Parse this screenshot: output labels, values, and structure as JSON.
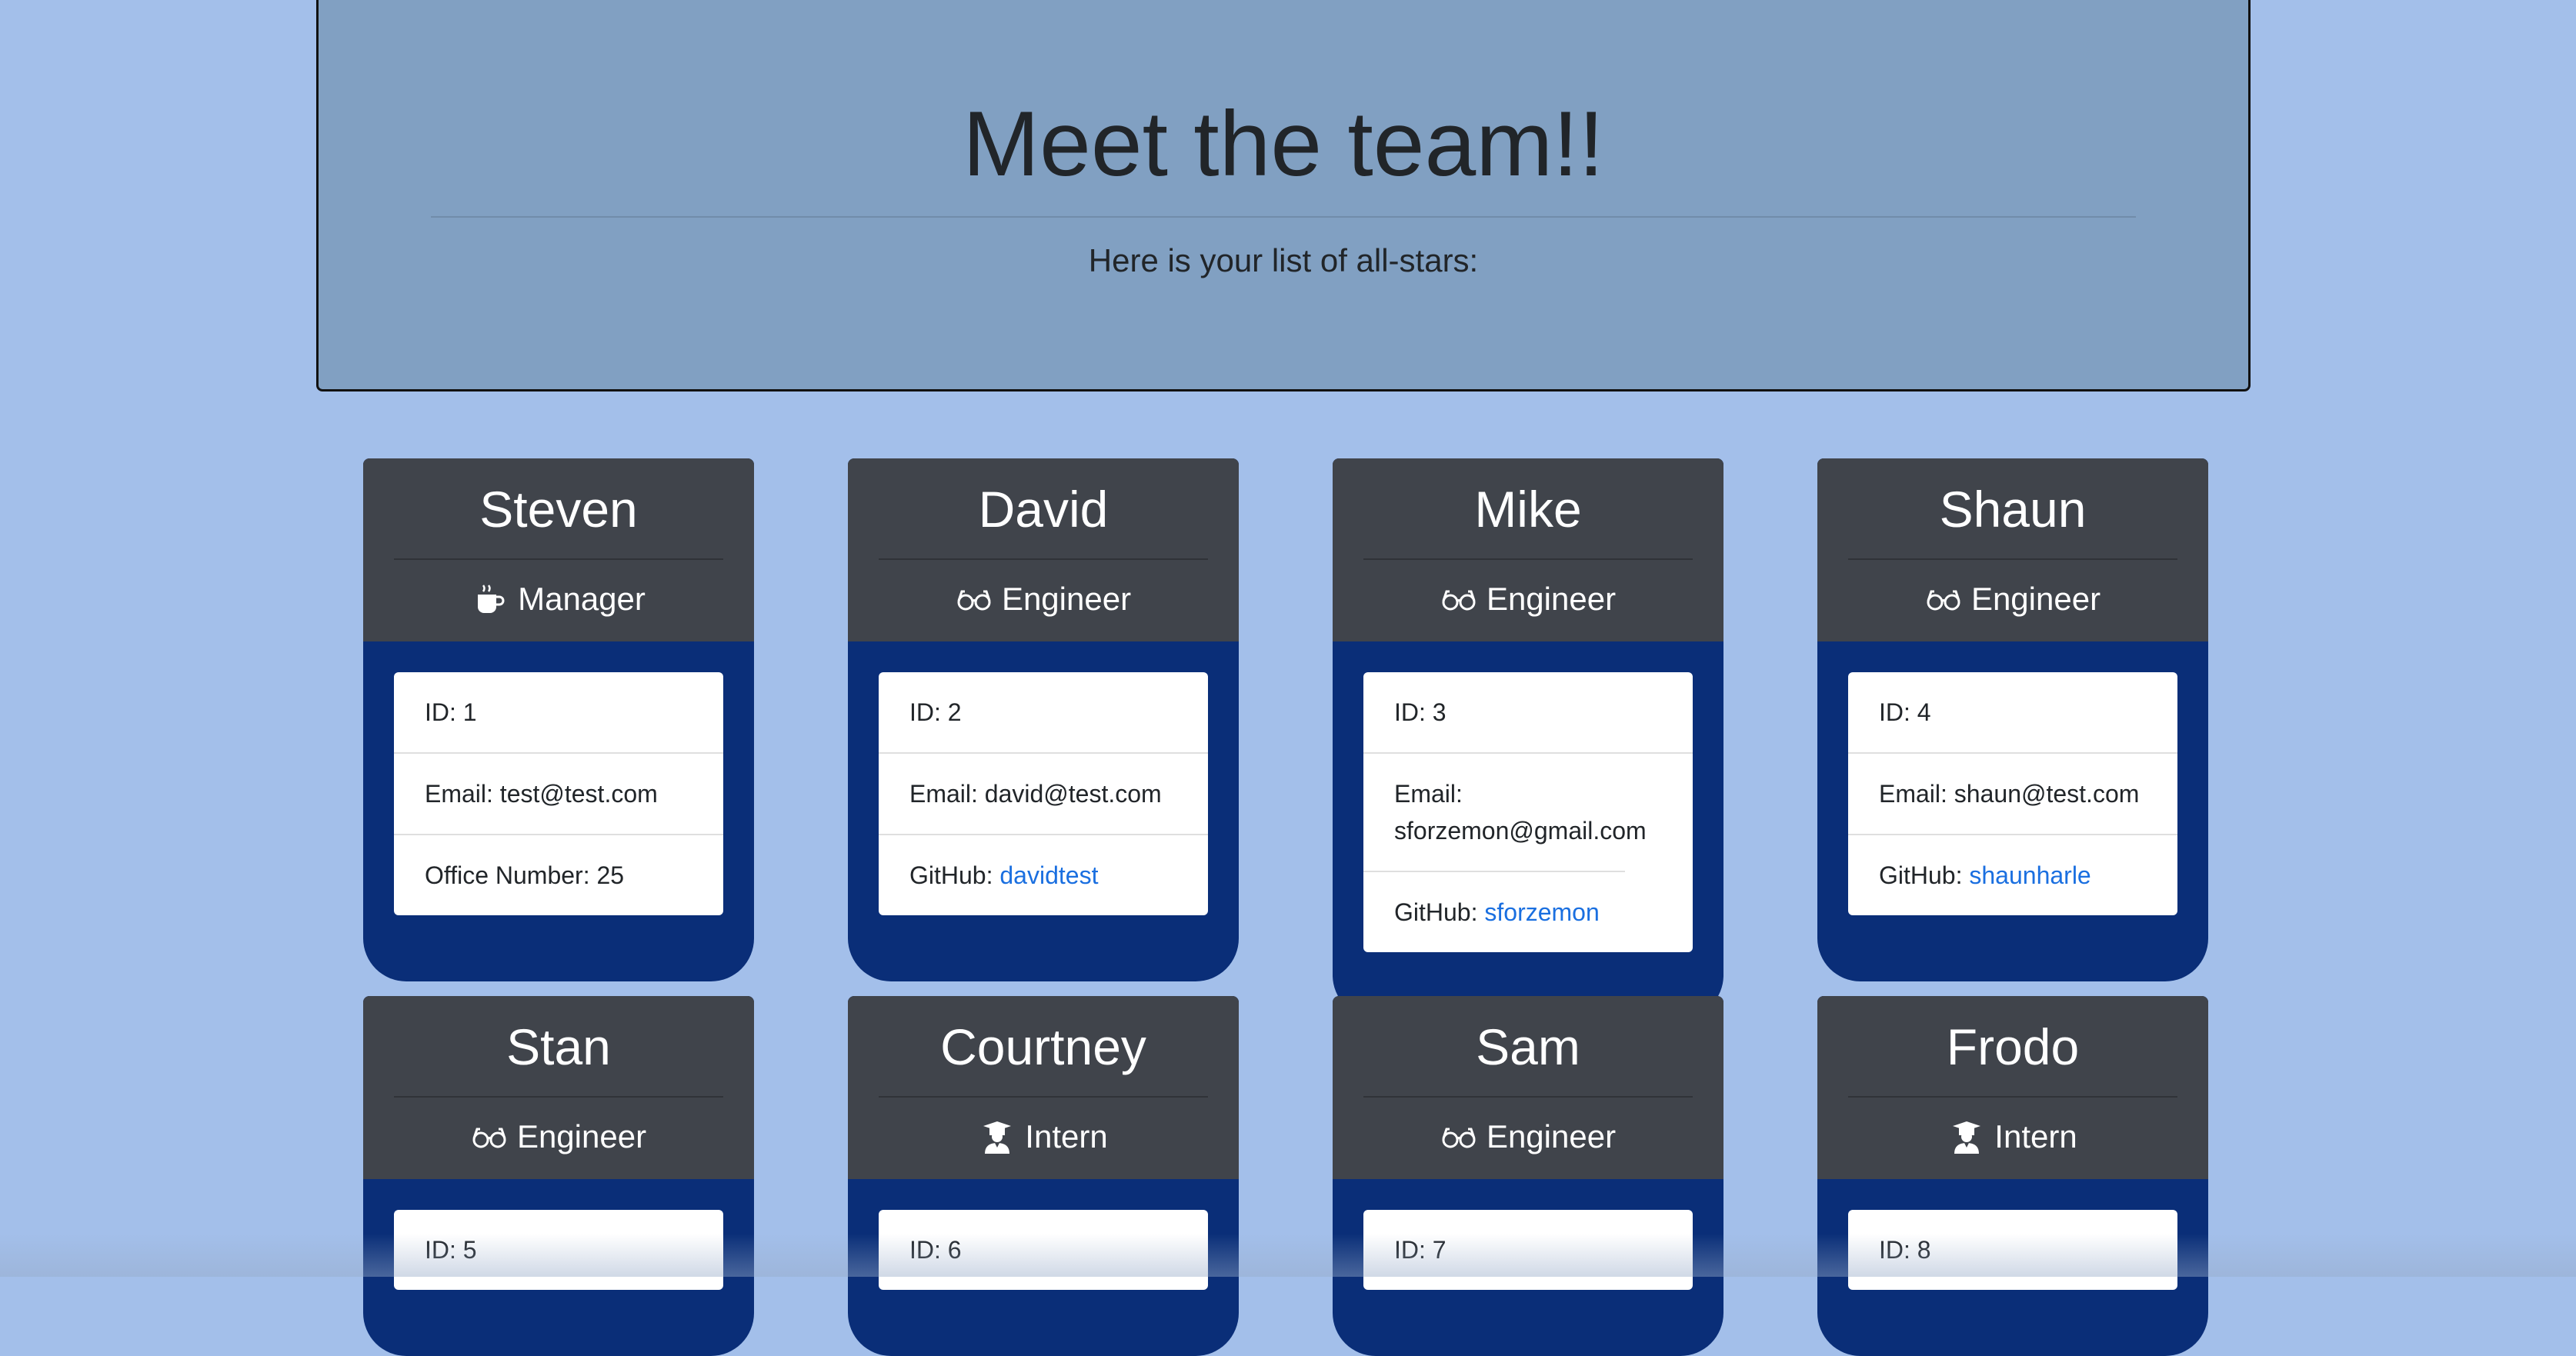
{
  "header": {
    "title": "Meet the team!!",
    "subtitle": "Here is your list of all-stars:"
  },
  "cards": [
    {
      "name": "Steven",
      "role": "Manager",
      "role_icon": "coffee-icon",
      "id": "ID: 1",
      "email": "Email: test@test.com",
      "extra_label": "Office Number: 25",
      "extra_link": ""
    },
    {
      "name": "David",
      "role": "Engineer",
      "role_icon": "glasses-icon",
      "id": "ID: 2",
      "email": "Email: david@test.com",
      "extra_label": "GitHub: ",
      "extra_link": "davidtest"
    },
    {
      "name": "Mike",
      "role": "Engineer",
      "role_icon": "glasses-icon",
      "id": "ID: 3",
      "email": "Email: sforzemon@gmail.com",
      "extra_label": "GitHub: ",
      "extra_link": "sforzemon"
    },
    {
      "name": "Shaun",
      "role": "Engineer",
      "role_icon": "glasses-icon",
      "id": "ID: 4",
      "email": "Email: shaun@test.com",
      "extra_label": "GitHub: ",
      "extra_link": "shaunharle"
    },
    {
      "name": "Stan",
      "role": "Engineer",
      "role_icon": "glasses-icon",
      "id": "ID: 5"
    },
    {
      "name": "Courtney",
      "role": "Intern",
      "role_icon": "graduate-icon",
      "id": "ID: 6"
    },
    {
      "name": "Sam",
      "role": "Engineer",
      "role_icon": "glasses-icon",
      "id": "ID: 7"
    },
    {
      "name": "Frodo",
      "role": "Intern",
      "role_icon": "graduate-icon",
      "id": "ID: 8"
    }
  ],
  "colors": {
    "page_bg": "#a3bfea",
    "jumbotron_bg": "#81a0c2",
    "card_header": "#40444b",
    "card_body": "#0a2e78",
    "link": "#1a6fe0"
  }
}
